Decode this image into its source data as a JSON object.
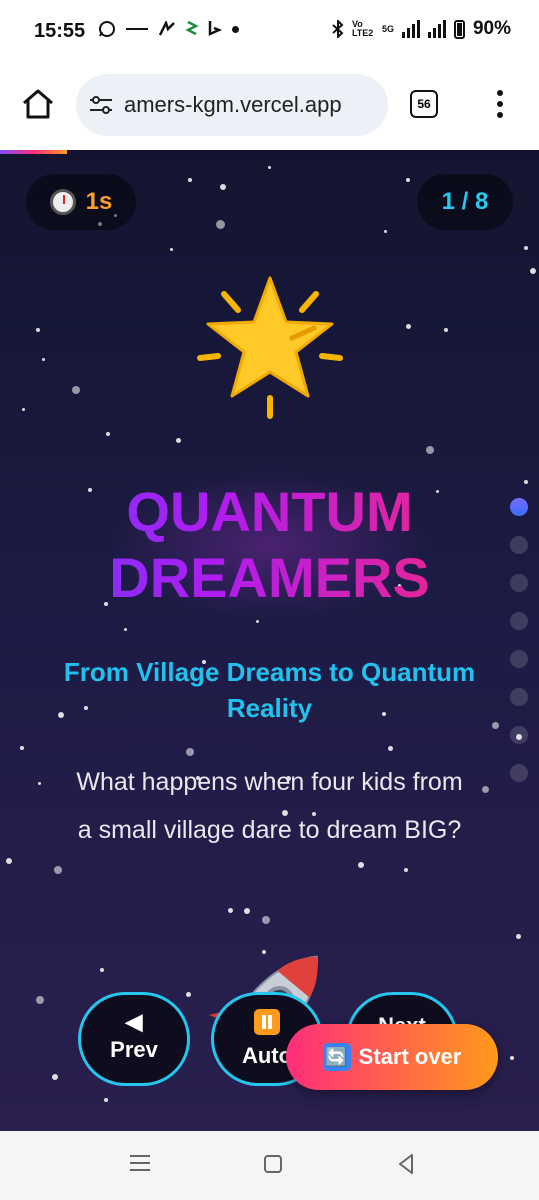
{
  "status_bar": {
    "time": "15:55",
    "battery": "90%",
    "network": "Vo LTE2",
    "signal_label": "5G"
  },
  "browser": {
    "url": "amers-kgm.vercel.app",
    "tab_count": "56"
  },
  "slide": {
    "timer": "1s",
    "counter": "1 / 8",
    "title_line1": "QUANTUM",
    "title_line2": "DREAMERS",
    "subtitle": "From Village Dreams to Quantum Reality",
    "description": "What happens when four kids from a small village dare to dream BIG?",
    "progress_fraction": 0.125,
    "total_dots": 8,
    "active_dot": 0
  },
  "controls": {
    "prev_icon": "◀",
    "prev_label": "Prev",
    "auto_label": "Auto",
    "next_label": "Next",
    "start_over_label": "Start over",
    "start_over_icon": "🔄"
  },
  "icons": {
    "home": "home-icon",
    "tune": "site-settings-icon",
    "menu": "more-vert-icon",
    "timer": "stopwatch-icon",
    "hero": "glowing-star-icon",
    "decor": "rocket-icon"
  },
  "colors": {
    "accent_cyan": "#25c6ee",
    "accent_orange": "#ff9a1a",
    "accent_pink": "#ff2d7a",
    "title_purple": "#b01cf0"
  }
}
